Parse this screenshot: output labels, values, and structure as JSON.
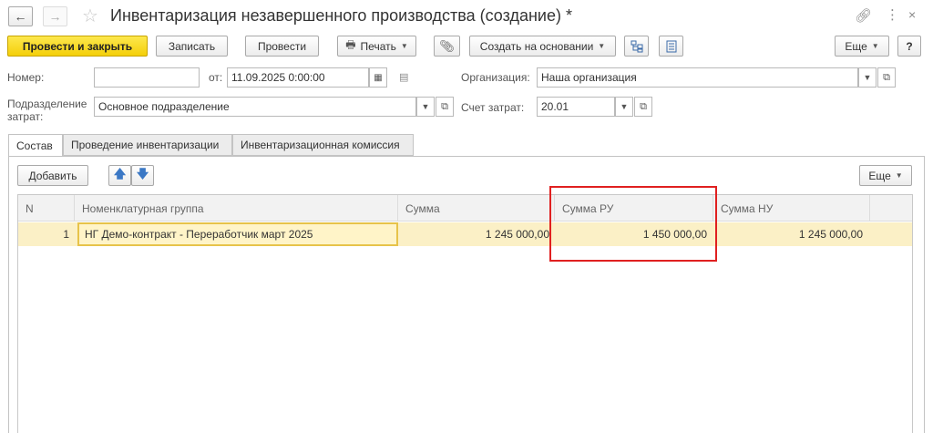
{
  "window": {
    "title": "Инвентаризация незавершенного производства (создание) *"
  },
  "toolbar": {
    "post_close": "Провести и закрыть",
    "save": "Записать",
    "post": "Провести",
    "print": "Печать",
    "create_based": "Создать на основании",
    "more": "Еще",
    "help": "?"
  },
  "form": {
    "number_label": "Номер:",
    "number_value": "",
    "date_label": "от:",
    "date_value": "11.09.2025  0:00:00",
    "org_label": "Организация:",
    "org_value": "Наша организация",
    "dept_label_1": "Подразделение",
    "dept_label_2": "затрат:",
    "dept_value": "Основное подразделение",
    "account_label": "Счет затрат:",
    "account_value": "20.01"
  },
  "tabs": [
    {
      "label": "Состав"
    },
    {
      "label": "Проведение инвентаризации"
    },
    {
      "label": "Инвентаризационная комиссия"
    }
  ],
  "table_toolbar": {
    "add": "Добавить",
    "more": "Еще"
  },
  "table": {
    "columns": [
      "N",
      "Номенклатурная группа",
      "Сумма",
      "Сумма РУ",
      "Сумма НУ"
    ],
    "rows": [
      {
        "n": "1",
        "group": "НГ Демо-контракт - Переработчик март 2025",
        "sum": "1 245 000,00",
        "sum_ru": "1 450 000,00",
        "sum_nu": "1 245 000,00"
      }
    ]
  },
  "colors": {
    "primary_button": "#f4cf0a",
    "row_highlight": "#fbf0c6",
    "annotation_box": "#e02020"
  }
}
